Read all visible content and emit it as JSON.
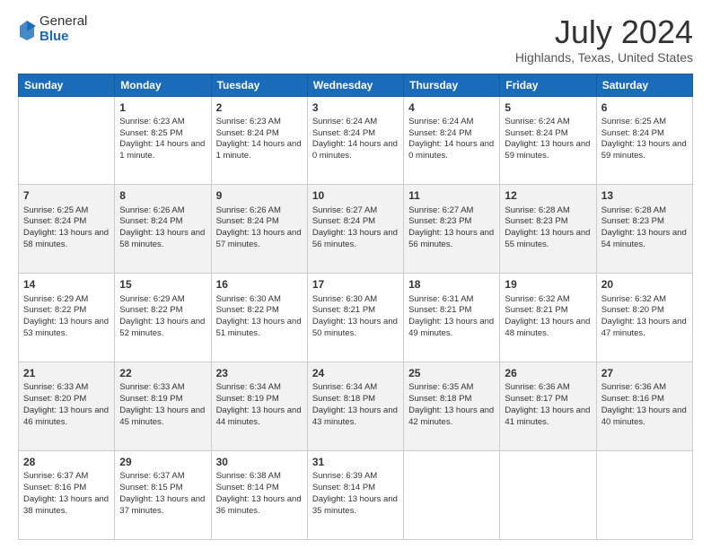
{
  "logo": {
    "general": "General",
    "blue": "Blue"
  },
  "title": "July 2024",
  "location": "Highlands, Texas, United States",
  "days_of_week": [
    "Sunday",
    "Monday",
    "Tuesday",
    "Wednesday",
    "Thursday",
    "Friday",
    "Saturday"
  ],
  "weeks": [
    [
      {
        "day": "",
        "content": ""
      },
      {
        "day": "1",
        "sunrise": "Sunrise: 6:23 AM",
        "sunset": "Sunset: 8:25 PM",
        "daylight": "Daylight: 14 hours and 1 minute."
      },
      {
        "day": "2",
        "sunrise": "Sunrise: 6:23 AM",
        "sunset": "Sunset: 8:24 PM",
        "daylight": "Daylight: 14 hours and 1 minute."
      },
      {
        "day": "3",
        "sunrise": "Sunrise: 6:24 AM",
        "sunset": "Sunset: 8:24 PM",
        "daylight": "Daylight: 14 hours and 0 minutes."
      },
      {
        "day": "4",
        "sunrise": "Sunrise: 6:24 AM",
        "sunset": "Sunset: 8:24 PM",
        "daylight": "Daylight: 14 hours and 0 minutes."
      },
      {
        "day": "5",
        "sunrise": "Sunrise: 6:24 AM",
        "sunset": "Sunset: 8:24 PM",
        "daylight": "Daylight: 13 hours and 59 minutes."
      },
      {
        "day": "6",
        "sunrise": "Sunrise: 6:25 AM",
        "sunset": "Sunset: 8:24 PM",
        "daylight": "Daylight: 13 hours and 59 minutes."
      }
    ],
    [
      {
        "day": "7",
        "sunrise": "Sunrise: 6:25 AM",
        "sunset": "Sunset: 8:24 PM",
        "daylight": "Daylight: 13 hours and 58 minutes."
      },
      {
        "day": "8",
        "sunrise": "Sunrise: 6:26 AM",
        "sunset": "Sunset: 8:24 PM",
        "daylight": "Daylight: 13 hours and 58 minutes."
      },
      {
        "day": "9",
        "sunrise": "Sunrise: 6:26 AM",
        "sunset": "Sunset: 8:24 PM",
        "daylight": "Daylight: 13 hours and 57 minutes."
      },
      {
        "day": "10",
        "sunrise": "Sunrise: 6:27 AM",
        "sunset": "Sunset: 8:24 PM",
        "daylight": "Daylight: 13 hours and 56 minutes."
      },
      {
        "day": "11",
        "sunrise": "Sunrise: 6:27 AM",
        "sunset": "Sunset: 8:23 PM",
        "daylight": "Daylight: 13 hours and 56 minutes."
      },
      {
        "day": "12",
        "sunrise": "Sunrise: 6:28 AM",
        "sunset": "Sunset: 8:23 PM",
        "daylight": "Daylight: 13 hours and 55 minutes."
      },
      {
        "day": "13",
        "sunrise": "Sunrise: 6:28 AM",
        "sunset": "Sunset: 8:23 PM",
        "daylight": "Daylight: 13 hours and 54 minutes."
      }
    ],
    [
      {
        "day": "14",
        "sunrise": "Sunrise: 6:29 AM",
        "sunset": "Sunset: 8:22 PM",
        "daylight": "Daylight: 13 hours and 53 minutes."
      },
      {
        "day": "15",
        "sunrise": "Sunrise: 6:29 AM",
        "sunset": "Sunset: 8:22 PM",
        "daylight": "Daylight: 13 hours and 52 minutes."
      },
      {
        "day": "16",
        "sunrise": "Sunrise: 6:30 AM",
        "sunset": "Sunset: 8:22 PM",
        "daylight": "Daylight: 13 hours and 51 minutes."
      },
      {
        "day": "17",
        "sunrise": "Sunrise: 6:30 AM",
        "sunset": "Sunset: 8:21 PM",
        "daylight": "Daylight: 13 hours and 50 minutes."
      },
      {
        "day": "18",
        "sunrise": "Sunrise: 6:31 AM",
        "sunset": "Sunset: 8:21 PM",
        "daylight": "Daylight: 13 hours and 49 minutes."
      },
      {
        "day": "19",
        "sunrise": "Sunrise: 6:32 AM",
        "sunset": "Sunset: 8:21 PM",
        "daylight": "Daylight: 13 hours and 48 minutes."
      },
      {
        "day": "20",
        "sunrise": "Sunrise: 6:32 AM",
        "sunset": "Sunset: 8:20 PM",
        "daylight": "Daylight: 13 hours and 47 minutes."
      }
    ],
    [
      {
        "day": "21",
        "sunrise": "Sunrise: 6:33 AM",
        "sunset": "Sunset: 8:20 PM",
        "daylight": "Daylight: 13 hours and 46 minutes."
      },
      {
        "day": "22",
        "sunrise": "Sunrise: 6:33 AM",
        "sunset": "Sunset: 8:19 PM",
        "daylight": "Daylight: 13 hours and 45 minutes."
      },
      {
        "day": "23",
        "sunrise": "Sunrise: 6:34 AM",
        "sunset": "Sunset: 8:19 PM",
        "daylight": "Daylight: 13 hours and 44 minutes."
      },
      {
        "day": "24",
        "sunrise": "Sunrise: 6:34 AM",
        "sunset": "Sunset: 8:18 PM",
        "daylight": "Daylight: 13 hours and 43 minutes."
      },
      {
        "day": "25",
        "sunrise": "Sunrise: 6:35 AM",
        "sunset": "Sunset: 8:18 PM",
        "daylight": "Daylight: 13 hours and 42 minutes."
      },
      {
        "day": "26",
        "sunrise": "Sunrise: 6:36 AM",
        "sunset": "Sunset: 8:17 PM",
        "daylight": "Daylight: 13 hours and 41 minutes."
      },
      {
        "day": "27",
        "sunrise": "Sunrise: 6:36 AM",
        "sunset": "Sunset: 8:16 PM",
        "daylight": "Daylight: 13 hours and 40 minutes."
      }
    ],
    [
      {
        "day": "28",
        "sunrise": "Sunrise: 6:37 AM",
        "sunset": "Sunset: 8:16 PM",
        "daylight": "Daylight: 13 hours and 38 minutes."
      },
      {
        "day": "29",
        "sunrise": "Sunrise: 6:37 AM",
        "sunset": "Sunset: 8:15 PM",
        "daylight": "Daylight: 13 hours and 37 minutes."
      },
      {
        "day": "30",
        "sunrise": "Sunrise: 6:38 AM",
        "sunset": "Sunset: 8:14 PM",
        "daylight": "Daylight: 13 hours and 36 minutes."
      },
      {
        "day": "31",
        "sunrise": "Sunrise: 6:39 AM",
        "sunset": "Sunset: 8:14 PM",
        "daylight": "Daylight: 13 hours and 35 minutes."
      },
      {
        "day": "",
        "content": ""
      },
      {
        "day": "",
        "content": ""
      },
      {
        "day": "",
        "content": ""
      }
    ]
  ]
}
